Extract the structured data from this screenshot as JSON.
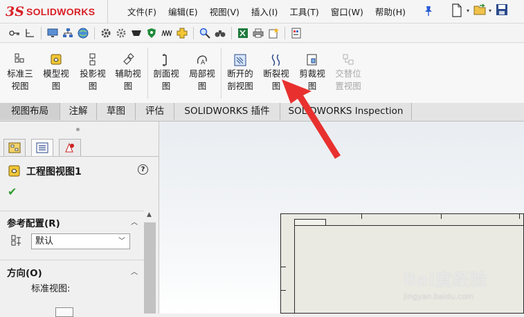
{
  "app": {
    "logo_prefix": "3S",
    "logo_text": "SOLIDWORKS",
    "menu": [
      "文件(F)",
      "编辑(E)",
      "视图(V)",
      "插入(I)",
      "工具(T)",
      "窗口(W)",
      "帮助(H)"
    ]
  },
  "ribbon": {
    "buttons": [
      {
        "line1": "标准三",
        "line2": "视图",
        "icon": "standard-3-view-icon",
        "enabled": true
      },
      {
        "line1": "模型视",
        "line2": "图",
        "icon": "model-view-icon",
        "enabled": true
      },
      {
        "line1": "投影视",
        "line2": "图",
        "icon": "projected-view-icon",
        "enabled": true
      },
      {
        "line1": "辅助视",
        "line2": "图",
        "icon": "auxiliary-view-icon",
        "enabled": true
      },
      {
        "line1": "剖面视",
        "line2": "图",
        "icon": "section-view-icon",
        "enabled": true
      },
      {
        "line1": "局部视",
        "line2": "图",
        "icon": "detail-view-icon",
        "enabled": true
      },
      {
        "line1": "断开的",
        "line2": "剖视图",
        "icon": "broken-out-section-icon",
        "enabled": true
      },
      {
        "line1": "断裂视",
        "line2": "图",
        "icon": "break-view-icon",
        "enabled": true
      },
      {
        "line1": "剪裁视",
        "line2": "图",
        "icon": "crop-view-icon",
        "enabled": true
      },
      {
        "line1": "交替位",
        "line2": "置视图",
        "icon": "alternate-position-view-icon",
        "enabled": false
      }
    ]
  },
  "tabs": [
    "视图布局",
    "注解",
    "草图",
    "评估",
    "SOLIDWORKS 插件",
    "SOLIDWORKS Inspection"
  ],
  "active_tab": "视图布局",
  "panel": {
    "title": "工程图视图1",
    "help": "?",
    "ref_config_header": "参考配置(R)",
    "ref_config_value": "默认",
    "orientation_header": "方向(O)",
    "standard_view_label": "标准视图:"
  },
  "watermark": {
    "brand": "Bai度经验",
    "url": "jingyan.baidu.com"
  },
  "colors": {
    "brand_red": "#da1f26",
    "annotation_red": "#e8312f",
    "check_green": "#2e9c2e"
  }
}
